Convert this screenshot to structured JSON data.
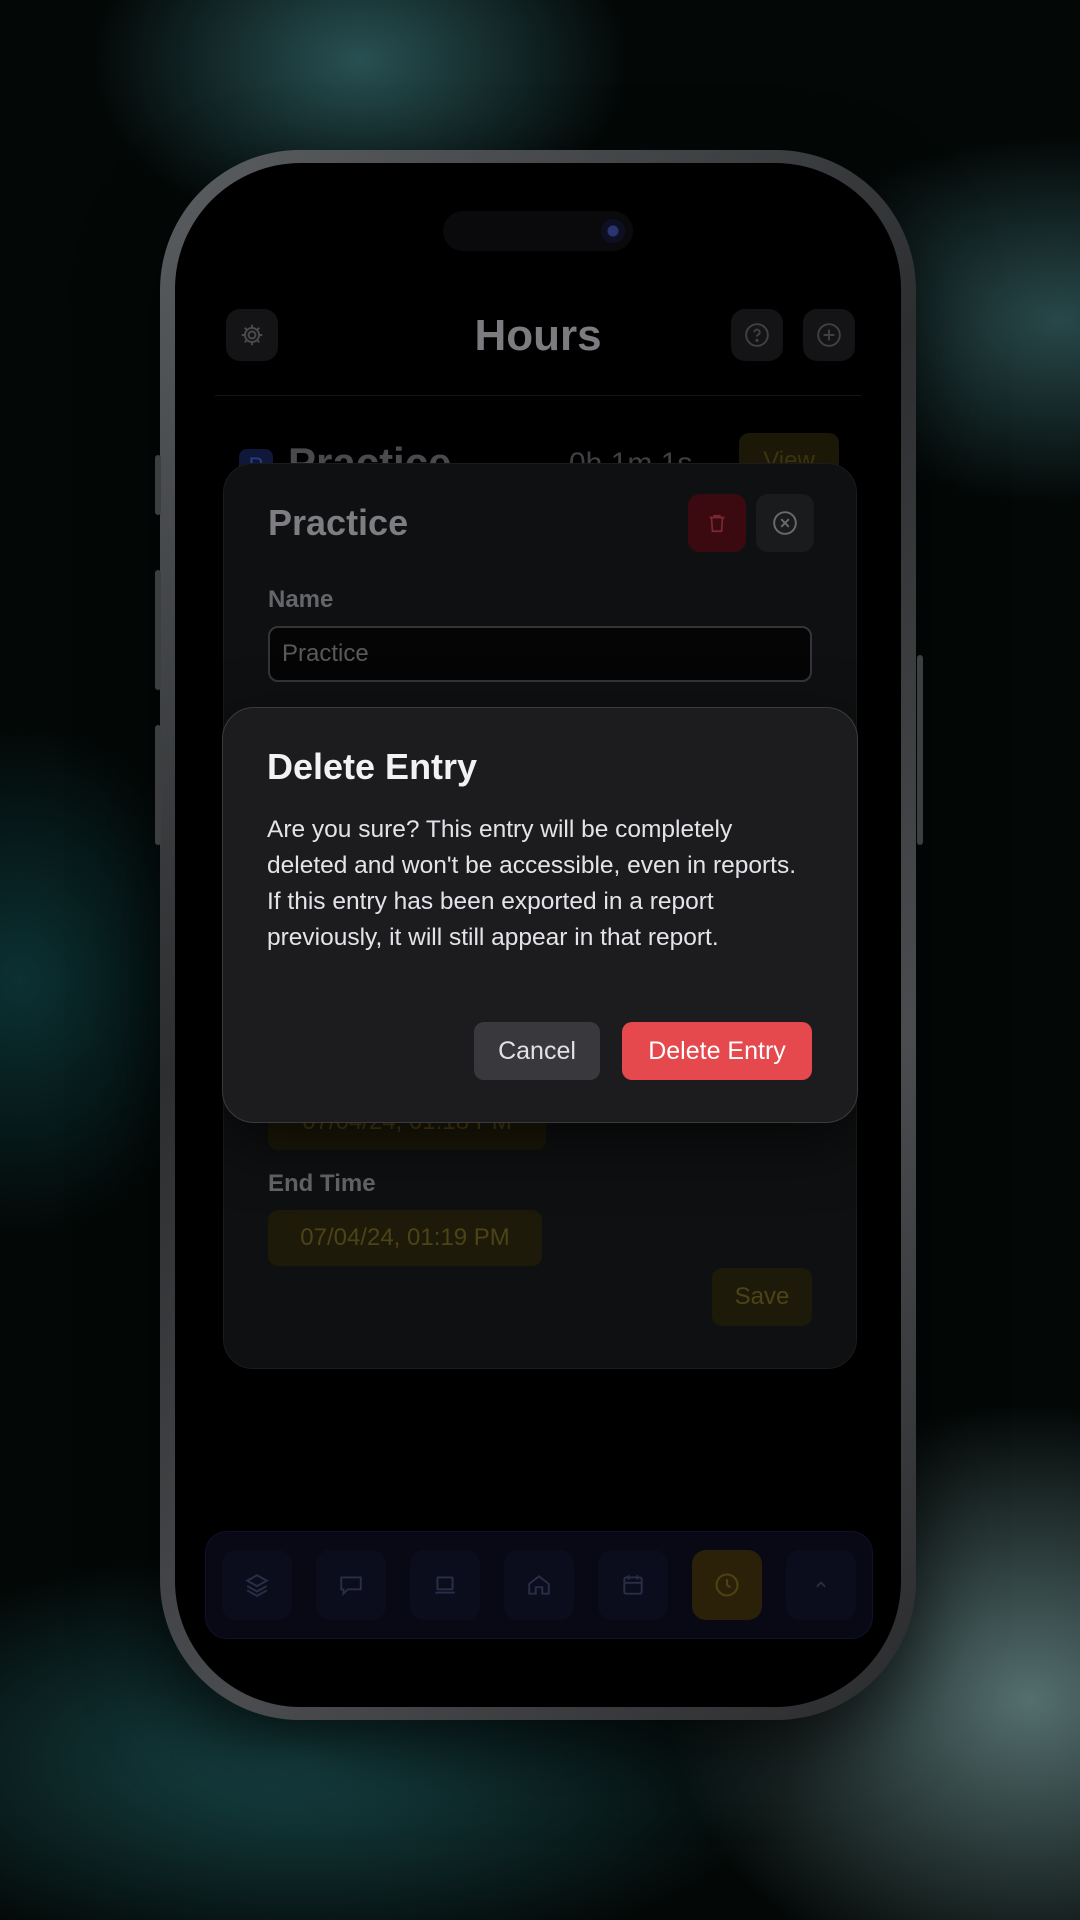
{
  "app": {
    "title": "Hours",
    "entry": {
      "avatar_letter": "P",
      "name": "Practice",
      "duration": "0h 1m 1s",
      "view_label": "View"
    }
  },
  "edit_panel": {
    "title": "Practice",
    "name_label": "Name",
    "name_value": "Practice",
    "start_time_value": "07/04/24, 01:18 PM",
    "end_time_label": "End Time",
    "end_time_value": "07/04/24, 01:19 PM",
    "save_label": "Save"
  },
  "dialog": {
    "title": "Delete Entry",
    "message": "Are you sure? This entry will be completely deleted and won't be accessible, even in reports. If this entry has been exported in a report previously, it will still appear in that report.",
    "cancel_label": "Cancel",
    "confirm_label": "Delete Entry"
  },
  "tabbar": {
    "tabs": [
      {
        "icon": "layers-icon"
      },
      {
        "icon": "chat-icon"
      },
      {
        "icon": "laptop-icon"
      },
      {
        "icon": "home-icon"
      },
      {
        "icon": "calendar-icon"
      },
      {
        "icon": "clock-icon",
        "active": true
      },
      {
        "icon": "chevron-up-icon"
      }
    ]
  },
  "colors": {
    "accent": "#e5484d",
    "dialog_bg": "#1c1c1f",
    "active_tab": "#2a2108"
  }
}
